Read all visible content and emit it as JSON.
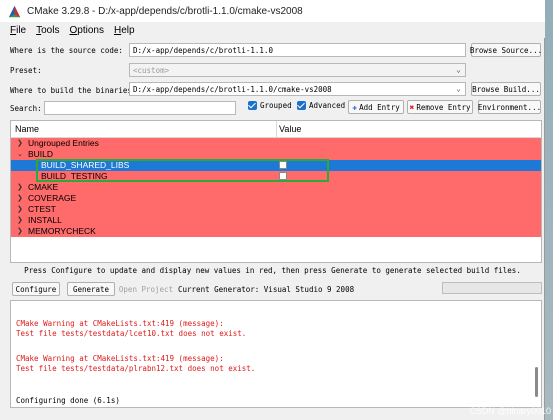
{
  "window": {
    "title": "CMake 3.29.8 - D:/x-app/depends/c/brotli-1.1.0/cmake-vs2008"
  },
  "menu": [
    {
      "label": "File",
      "accel": "F",
      "rest": "ile"
    },
    {
      "label": "Tools",
      "accel": "T",
      "rest": "ools"
    },
    {
      "label": "Options",
      "accel": "O",
      "rest": "ptions"
    },
    {
      "label": "Help",
      "accel": "H",
      "rest": "elp"
    }
  ],
  "source": {
    "label": "Where is the source code:",
    "value": "D:/x-app/depends/c/brotli-1.1.0",
    "button": "Browse Source..."
  },
  "preset": {
    "label": "Preset:",
    "value": "<custom>"
  },
  "build": {
    "label": "Where to build the binaries:",
    "value": "D:/x-app/depends/c/brotli-1.1.0/cmake-vs2008",
    "button": "Browse Build..."
  },
  "search": {
    "label": "Search:",
    "value": ""
  },
  "toggles": {
    "grouped": {
      "label": "Grouped",
      "checked": true
    },
    "advanced": {
      "label": "Advanced",
      "checked": true
    }
  },
  "actions": {
    "add_entry": "Add Entry",
    "remove_entry": "Remove Entry",
    "environment": "Environment..."
  },
  "tree": {
    "headers": {
      "name": "Name",
      "value": "Value"
    },
    "rows": [
      {
        "label": "Ungrouped Entries",
        "chevron": ">",
        "level": 0
      },
      {
        "label": "BUILD",
        "chevron": "v",
        "level": 0
      },
      {
        "label": "BUILD_SHARED_LIBS",
        "chevron": "",
        "level": 1,
        "checkbox": false,
        "selected": true
      },
      {
        "label": "BUILD_TESTING",
        "chevron": "",
        "level": 1,
        "checkbox": false
      },
      {
        "label": "CMAKE",
        "chevron": ">",
        "level": 0
      },
      {
        "label": "COVERAGE",
        "chevron": ">",
        "level": 0
      },
      {
        "label": "CTEST",
        "chevron": ">",
        "level": 0
      },
      {
        "label": "INSTALL",
        "chevron": ">",
        "level": 0
      },
      {
        "label": "MEMORYCHECK",
        "chevron": ">",
        "level": 0
      }
    ]
  },
  "info_text": "Press Configure to update and display new values in red, then press Generate to generate selected build files.",
  "bottom": {
    "configure": "Configure",
    "generate": "Generate",
    "open_project": "Open Project",
    "current_generator": "Current Generator: Visual Studio 9 2008"
  },
  "output": {
    "lines": [
      {
        "text": "CMake Warning at CMakeLists.txt:419 (message):",
        "type": "warn"
      },
      {
        "text": "  Test file tests/testdata/lcet10.txt does not exist.",
        "type": "warn"
      },
      {
        "text": "CMake Warning at CMakeLists.txt:419 (message):",
        "type": "warn"
      },
      {
        "text": "  Test file tests/testdata/plrabn12.txt does not exist.",
        "type": "warn"
      },
      {
        "text": "Configuring done (6.1s)",
        "type": "normal"
      }
    ]
  },
  "watermark": "CSDN @binary0010",
  "colors": {
    "changed_row": "#ff6a6a",
    "selected_row": "#1e78d6",
    "highlight_box": "#2fa83a",
    "warning_text": "#e01a1a",
    "checkbox_blue": "#1a73c9"
  }
}
